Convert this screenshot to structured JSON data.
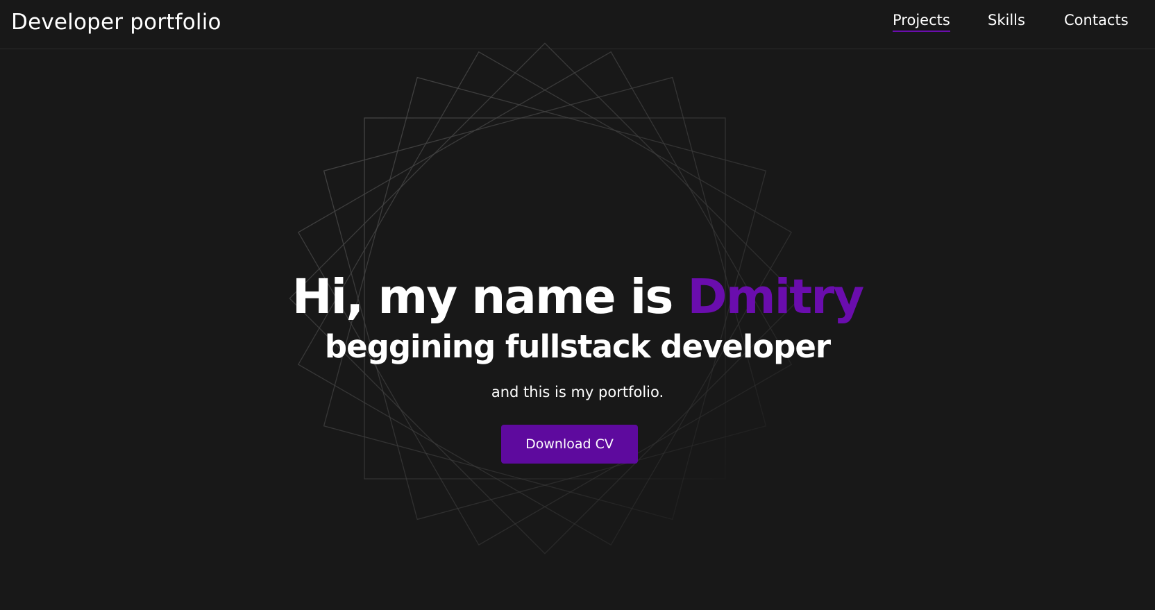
{
  "header": {
    "logo": "Developer portfolio",
    "nav": [
      {
        "label": "Projects",
        "active": true
      },
      {
        "label": "Skills",
        "active": false
      },
      {
        "label": "Contacts",
        "active": false
      }
    ]
  },
  "hero": {
    "greeting": "Hi, my name is ",
    "name": "Dmitry",
    "subtitle": "beggining fullstack developer",
    "tagline": "and this is my portfolio.",
    "cta_label": "Download CV"
  },
  "colors": {
    "background": "#181818",
    "accent": "#6a0dad",
    "button": "#5e0a9e",
    "text": "#ffffff",
    "decor_lines": "#3a3a3a"
  }
}
